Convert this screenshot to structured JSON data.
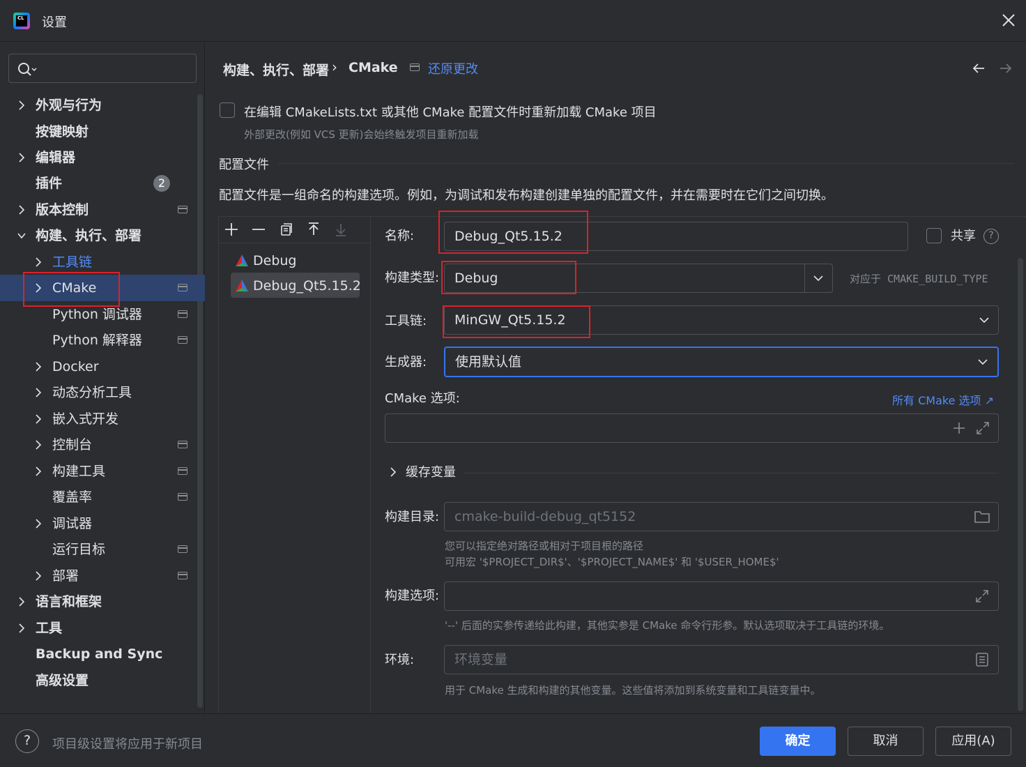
{
  "window": {
    "title": "设置"
  },
  "search": {
    "placeholder": ""
  },
  "sidebar": {
    "items": [
      {
        "label": "外观与行为"
      },
      {
        "label": "按键映射"
      },
      {
        "label": "编辑器"
      },
      {
        "label": "插件",
        "badge": "2"
      },
      {
        "label": "版本控制"
      },
      {
        "label": "构建、执行、部署"
      },
      {
        "label": "工具链"
      },
      {
        "label": "CMake"
      },
      {
        "label": "Python 调试器"
      },
      {
        "label": "Python 解释器"
      },
      {
        "label": "Docker"
      },
      {
        "label": "动态分析工具"
      },
      {
        "label": "嵌入式开发"
      },
      {
        "label": "控制台"
      },
      {
        "label": "构建工具"
      },
      {
        "label": "覆盖率"
      },
      {
        "label": "调试器"
      },
      {
        "label": "运行目标"
      },
      {
        "label": "部署"
      },
      {
        "label": "语言和框架"
      },
      {
        "label": "工具"
      },
      {
        "label": "Backup and Sync"
      },
      {
        "label": "高级设置"
      }
    ]
  },
  "header": {
    "breadcrumb_parent": "构建、执行、部署",
    "breadcrumb_sep": "›",
    "breadcrumb_current": "CMake",
    "revert_label": "还原更改"
  },
  "reload": {
    "checkbox_label": "在编辑 CMakeLists.txt 或其他 CMake 配置文件时重新加载 CMake 项目",
    "hint": "外部更改(例如 VCS 更新)会始终触发项目重新加载"
  },
  "profiles": {
    "section_title": "配置文件",
    "description": "配置文件是一组命名的构建选项。例如，为调试和发布构建创建单独的配置文件，并在需要时在它们之间切换。",
    "list": [
      {
        "name": "Debug"
      },
      {
        "name": "Debug_Qt5.15.2"
      }
    ]
  },
  "form": {
    "name_label": "名称:",
    "name_value": "Debug_Qt5.15.2",
    "share_label": "共享",
    "build_type_label": "构建类型:",
    "build_type_value": "Debug",
    "build_type_hint": "对应于 CMAKE_BUILD_TYPE",
    "toolchain_label": "工具链:",
    "toolchain_value": "MinGW_Qt5.15.2",
    "generator_label": "生成器:",
    "generator_value": "使用默认值",
    "cmake_options_label": "CMake 选项:",
    "all_cmake_options_link": "所有 CMake 选项 ↗",
    "cmake_options_value": "",
    "cache_vars_label": "缓存变量",
    "build_dir_label": "构建目录:",
    "build_dir_placeholder": "cmake-build-debug_qt5152",
    "build_dir_hint1": "您可以指定绝对路径或相对于项目根的路径",
    "build_dir_hint2": "可用宏 '$PROJECT_DIR$'、'$PROJECT_NAME$' 和 '$USER_HOME$'",
    "build_options_label": "构建选项:",
    "build_options_value": "",
    "build_options_hint": "'--' 后面的实参传递给此构建，其他实参是 CMake 命令行形参。默认选项取决于工具链的环境。",
    "env_label": "环境:",
    "env_placeholder": "环境变量",
    "env_hint": "用于 CMake 生成和构建的其他变量。这些值将添加到系统变量和工具链变量中。"
  },
  "footer": {
    "help_text": "项目级设置将应用于新项目",
    "ok_label": "确定",
    "cancel_label": "取消",
    "apply_label": "应用(A)"
  },
  "colors": {
    "accent": "#3574f0",
    "link": "#548af7",
    "highlight_box": "#e0202a",
    "selection": "#2e436e"
  }
}
